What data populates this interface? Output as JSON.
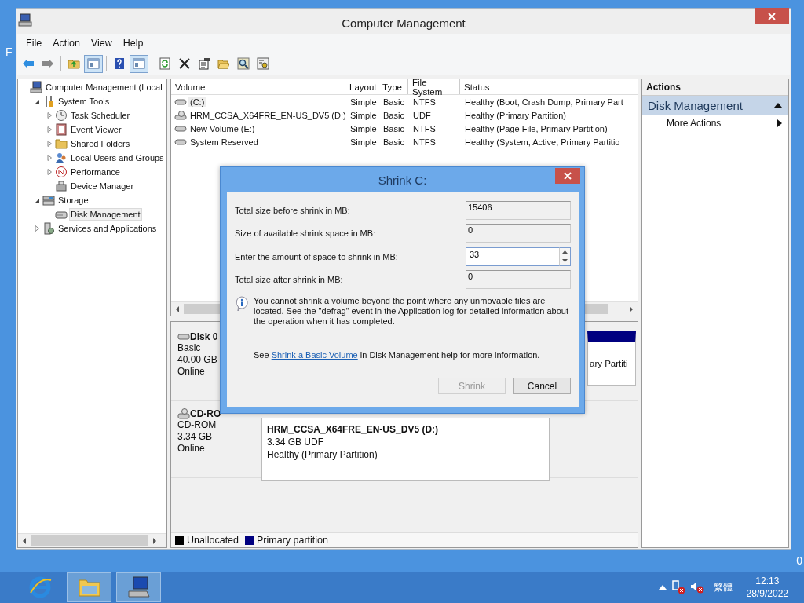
{
  "desktop": {
    "edge_labels": [
      {
        "text": "F"
      },
      {
        "text": "0"
      }
    ]
  },
  "window": {
    "title": "Computer Management"
  },
  "menu": [
    "File",
    "Action",
    "View",
    "Help"
  ],
  "toolbar": [
    {
      "kind": "button",
      "pressed": false
    },
    {
      "kind": "button",
      "pressed": false
    },
    {
      "kind": "separator"
    },
    {
      "kind": "button",
      "pressed": false
    },
    {
      "kind": "button",
      "pressed": true
    },
    {
      "kind": "separator"
    },
    {
      "kind": "button",
      "pressed": false
    },
    {
      "kind": "button",
      "pressed": true
    },
    {
      "kind": "separator"
    },
    {
      "kind": "button",
      "pressed": false
    },
    {
      "kind": "button",
      "pressed": false
    },
    {
      "kind": "button",
      "pressed": false
    },
    {
      "kind": "button",
      "pressed": false
    },
    {
      "kind": "button",
      "pressed": false
    },
    {
      "kind": "button",
      "pressed": false
    }
  ],
  "tree": [
    {
      "label": "Computer Management (Local",
      "selected": false,
      "children": [
        {
          "label": "System Tools",
          "expanded": true,
          "selected": false,
          "children": [
            {
              "label": "Task Scheduler",
              "expanded": false,
              "selected": false
            },
            {
              "label": "Event Viewer",
              "expanded": false,
              "selected": false
            },
            {
              "label": "Shared Folders",
              "expanded": false,
              "selected": false
            },
            {
              "label": "Local Users and Groups",
              "expanded": false,
              "selected": false
            },
            {
              "label": "Performance",
              "expanded": false,
              "selected": false
            },
            {
              "label": "Device Manager",
              "selected": false
            }
          ]
        },
        {
          "label": "Storage",
          "expanded": true,
          "selected": false,
          "children": [
            {
              "label": "Disk Management",
              "selected": true
            }
          ]
        },
        {
          "label": "Services and Applications",
          "expanded": false,
          "selected": false
        }
      ]
    }
  ],
  "volumes": {
    "columns": [
      "Volume",
      "Layout",
      "Type",
      "File System",
      "Status"
    ],
    "rows": [
      {
        "kind": "disk",
        "selected": true,
        "cells": [
          "(C:)",
          "Simple",
          "Basic",
          "NTFS",
          "Healthy (Boot, Crash Dump, Primary Part"
        ]
      },
      {
        "kind": "cd",
        "selected": false,
        "cells": [
          "HRM_CCSA_X64FRE_EN-US_DV5 (D:)",
          "Simple",
          "Basic",
          "UDF",
          "Healthy (Primary Partition)"
        ]
      },
      {
        "kind": "disk",
        "selected": false,
        "cells": [
          "New Volume (E:)",
          "Simple",
          "Basic",
          "NTFS",
          "Healthy (Page File, Primary Partition)"
        ]
      },
      {
        "kind": "disk",
        "selected": false,
        "cells": [
          "System Reserved",
          "Simple",
          "Basic",
          "NTFS",
          "Healthy (System, Active, Primary Partitio"
        ]
      }
    ]
  },
  "disks": [
    {
      "kind": "disk",
      "name": "Disk 0",
      "lines": [
        "Basic",
        "40.00 GB",
        "Online"
      ],
      "partition": {
        "lines": [
          "ary Partiti"
        ]
      }
    },
    {
      "kind": "cd",
      "name": "CD-RO",
      "lines": [
        "CD-ROM",
        "3.34 GB",
        "Online"
      ],
      "partition": {
        "title": "HRM_CCSA_X64FRE_EN-US_DV5  (D:)",
        "lines": [
          "3.34 GB UDF",
          "Healthy (Primary Partition)"
        ]
      }
    }
  ],
  "legend": [
    {
      "label": "Unallocated",
      "color": "#000000"
    },
    {
      "label": "Primary partition",
      "color": "#000080"
    }
  ],
  "actions": {
    "header": "Actions",
    "sections": [
      {
        "title": "Disk Management",
        "expanded": true,
        "items": [
          "More Actions"
        ]
      }
    ]
  },
  "dialog": {
    "title": "Shrink C:",
    "fields": [
      {
        "kind": "readonly",
        "label": "Total size before shrink in MB:",
        "value": "15406"
      },
      {
        "kind": "readonly",
        "label": "Size of available shrink space in MB:",
        "value": "0"
      },
      {
        "kind": "spin",
        "label": "Enter the amount of space to shrink in MB:",
        "value": "33"
      },
      {
        "kind": "readonly",
        "label": "Total size after shrink in MB:",
        "value": "0"
      }
    ],
    "info": "You cannot shrink a volume beyond the point where any unmovable files are located. See the \"defrag\" event in the Application log for detailed information about the operation when it has completed.",
    "help": {
      "before": "See ",
      "link": "Shrink a Basic Volume",
      "after": " in Disk Management help for more information."
    },
    "buttons": [
      {
        "label": "Shrink",
        "disabled": true
      },
      {
        "label": "Cancel",
        "disabled": false
      }
    ]
  },
  "taskbar": {
    "apps": [
      {
        "active": false
      },
      {
        "active": true
      },
      {
        "active": true
      }
    ],
    "language": "繁體",
    "time": "12:13",
    "date": "28/9/2022"
  }
}
